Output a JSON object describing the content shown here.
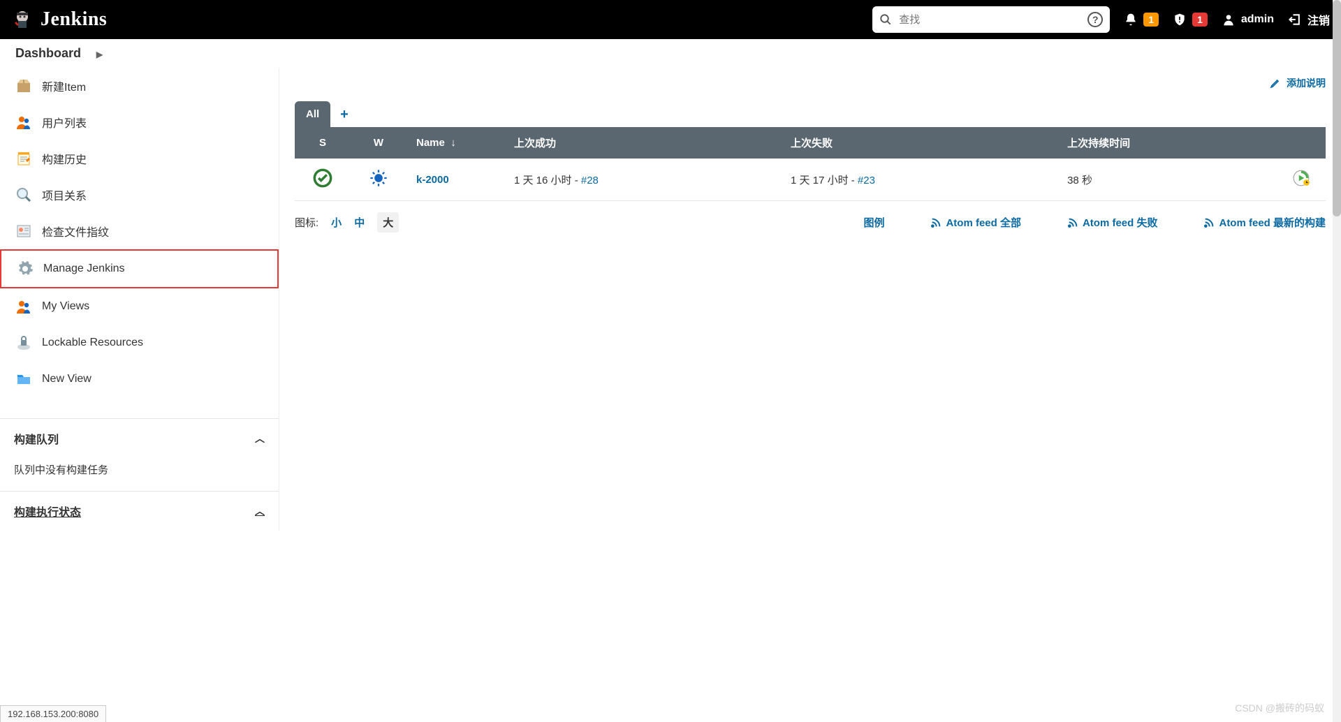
{
  "header": {
    "brand": "Jenkins",
    "search_placeholder": "查找",
    "bell_badge": "1",
    "shield_badge": "1",
    "user": "admin",
    "logout": "注销"
  },
  "breadcrumb": {
    "item1": "Dashboard"
  },
  "side_nav": {
    "items": [
      {
        "label": "新建Item"
      },
      {
        "label": "用户列表"
      },
      {
        "label": "构建历史"
      },
      {
        "label": "项目关系"
      },
      {
        "label": "检查文件指纹"
      },
      {
        "label": "Manage Jenkins"
      },
      {
        "label": "My Views"
      },
      {
        "label": "Lockable Resources"
      },
      {
        "label": "New View"
      }
    ]
  },
  "panes": {
    "build_queue_title": "构建队列",
    "build_queue_empty": "队列中没有构建任务",
    "executor_title": "构建执行状态"
  },
  "main": {
    "add_description": "添加说明",
    "tabs": {
      "all": "All"
    },
    "columns": {
      "status": "S",
      "weather": "W",
      "name": "Name",
      "name_sort": "↓",
      "last_success": "上次成功",
      "last_failure": "上次失败",
      "last_duration": "上次持续时间"
    },
    "rows": [
      {
        "name": "k-2000",
        "last_success_text": "1 天 16 小时 - ",
        "last_success_build": "#28",
        "last_failure_text": "1 天 17 小时 - ",
        "last_failure_build": "#23",
        "duration": "38 秒"
      }
    ],
    "icon_label": "图标:",
    "size_small": "小",
    "size_medium": "中",
    "size_large": "大",
    "legend": "图例",
    "feed_all": "Atom feed 全部",
    "feed_fail": "Atom feed 失败",
    "feed_latest": "Atom feed 最新的构建"
  },
  "status_bar": "192.168.153.200:8080",
  "watermark": "CSDN @搬砖的码蚁"
}
